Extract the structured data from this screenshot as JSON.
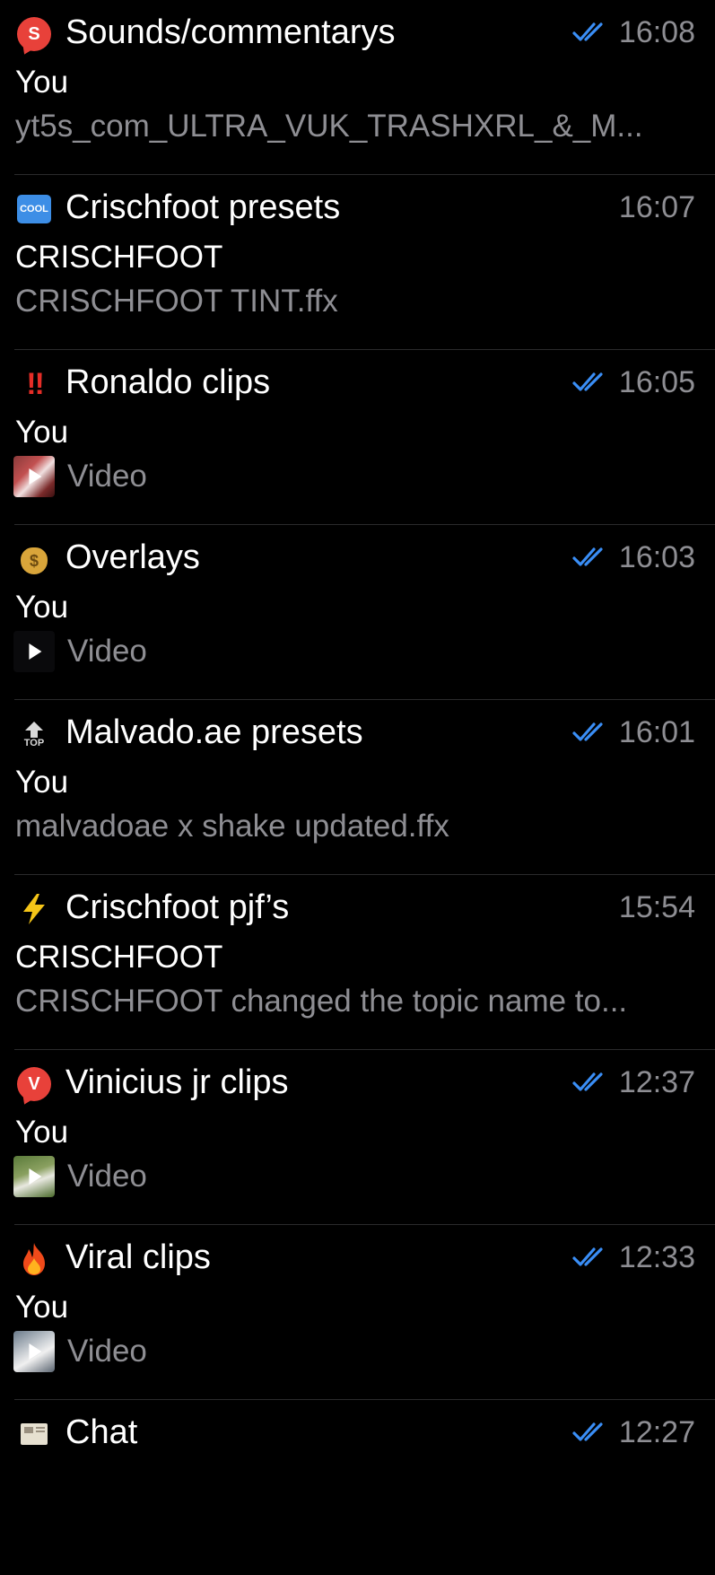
{
  "topics": [
    {
      "icon": "red-speech-bubble-s-icon",
      "icon_letter": "S",
      "title": "Sounds/commentarys",
      "time": "16:08",
      "read": true,
      "sender": "You",
      "preview": "yt5s_com_ULTRA_VUK_TRASHXRL_&_M...",
      "media": false
    },
    {
      "icon": "cool-button-icon",
      "icon_letter": "COOL",
      "title": "Crischfoot presets",
      "time": "16:07",
      "read": false,
      "sender": "CRISCHFOOT",
      "preview": "CRISCHFOOT TINT.ffx",
      "media": false
    },
    {
      "icon": "double-exclamation-icon",
      "icon_letter": "‼",
      "title": "Ronaldo clips",
      "time": "16:05",
      "read": true,
      "sender": "You",
      "preview": "Video",
      "media": true
    },
    {
      "icon": "money-bag-icon",
      "icon_letter": "$",
      "title": "Overlays",
      "time": "16:03",
      "read": true,
      "sender": "You",
      "preview": "Video",
      "media": true
    },
    {
      "icon": "top-arrow-icon",
      "icon_letter": "TOP",
      "title": "Malvado.ae presets",
      "time": "16:01",
      "read": true,
      "sender": "You",
      "preview": "malvadoae x shake updated.ffx",
      "media": false
    },
    {
      "icon": "lightning-icon",
      "icon_letter": "⚡",
      "title": "Crischfoot pjf’s",
      "time": "15:54",
      "read": false,
      "sender": "CRISCHFOOT",
      "preview": "CRISCHFOOT changed the topic name to...",
      "media": false
    },
    {
      "icon": "red-speech-bubble-v-icon",
      "icon_letter": "V",
      "title": "Vinicius jr clips",
      "time": "12:37",
      "read": true,
      "sender": "You",
      "preview": "Video",
      "media": true
    },
    {
      "icon": "fire-icon",
      "icon_letter": "🔥",
      "title": "Viral clips",
      "time": "12:33",
      "read": true,
      "sender": "You",
      "preview": "Video",
      "media": true
    },
    {
      "icon": "newspaper-icon",
      "icon_letter": "",
      "title": "Chat",
      "time": "12:27",
      "read": true,
      "sender": "",
      "preview": "",
      "media": false
    }
  ],
  "colors": {
    "background": "#000000",
    "text_primary": "#ffffff",
    "text_secondary": "#8e8e93",
    "read_check": "#3a8ef6",
    "divider": "#2a2a2c"
  }
}
